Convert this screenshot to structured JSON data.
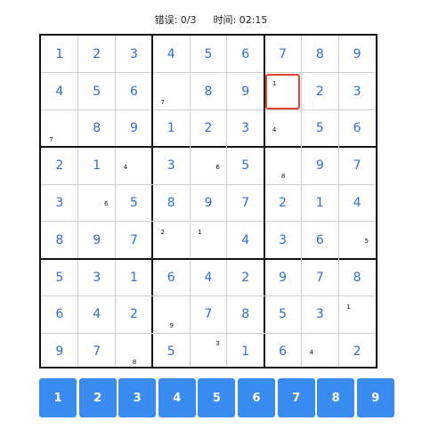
{
  "status": {
    "errors_label": "错误:",
    "errors_value": "0/3",
    "time_label": "时间:",
    "time_value": "02:15"
  },
  "board": {
    "rows": [
      [
        "1",
        "2",
        "3",
        "4",
        "5",
        "6",
        "7",
        "8",
        "9"
      ],
      [
        "4",
        "5",
        "6",
        "",
        "8",
        "9",
        "",
        "2",
        "3"
      ],
      [
        "",
        "8",
        "9",
        "1",
        "2",
        "3",
        "",
        "5",
        "6"
      ],
      [
        "2",
        "1",
        "",
        "3",
        "",
        "5",
        "",
        "9",
        "7"
      ],
      [
        "3",
        "",
        "5",
        "8",
        "9",
        "7",
        "2",
        "1",
        "4"
      ],
      [
        "8",
        "9",
        "7",
        "",
        "",
        "4",
        "3",
        "6",
        ""
      ],
      [
        "5",
        "3",
        "1",
        "6",
        "4",
        "2",
        "9",
        "7",
        "8"
      ],
      [
        "6",
        "4",
        "2",
        "",
        "7",
        "8",
        "5",
        "3",
        ""
      ],
      [
        "9",
        "7",
        "",
        "5",
        "",
        "1",
        "6",
        "",
        "2"
      ]
    ],
    "notes": [
      {
        "r": 1,
        "c": 3,
        "text": "7",
        "pos": "bl"
      },
      {
        "r": 1,
        "c": 6,
        "text": "1",
        "pos": "tl"
      },
      {
        "r": 2,
        "c": 0,
        "text": "7",
        "pos": "bl"
      },
      {
        "r": 2,
        "c": 6,
        "text": "4",
        "pos": "ml"
      },
      {
        "r": 3,
        "c": 2,
        "text": "4",
        "pos": "ml"
      },
      {
        "r": 3,
        "c": 4,
        "text": "6",
        "pos": "mr"
      },
      {
        "r": 3,
        "c": 6,
        "text": "8",
        "pos": "bm"
      },
      {
        "r": 4,
        "c": 1,
        "text": "6",
        "pos": "mr"
      },
      {
        "r": 5,
        "c": 3,
        "text": "2",
        "pos": "tl"
      },
      {
        "r": 5,
        "c": 4,
        "text": "1",
        "pos": "tl"
      },
      {
        "r": 5,
        "c": 8,
        "text": "5",
        "pos": "mr"
      },
      {
        "r": 7,
        "c": 3,
        "text": "9",
        "pos": "bm"
      },
      {
        "r": 7,
        "c": 8,
        "text": "1",
        "pos": "tl"
      },
      {
        "r": 8,
        "c": 2,
        "text": "8",
        "pos": "bm"
      },
      {
        "r": 8,
        "c": 4,
        "text": "3",
        "pos": "tr"
      },
      {
        "r": 8,
        "c": 7,
        "text": "4",
        "pos": "ml"
      }
    ],
    "selected": {
      "r": 1,
      "c": 6
    }
  },
  "numpad": [
    "1",
    "2",
    "3",
    "4",
    "5",
    "6",
    "7",
    "8",
    "9"
  ]
}
